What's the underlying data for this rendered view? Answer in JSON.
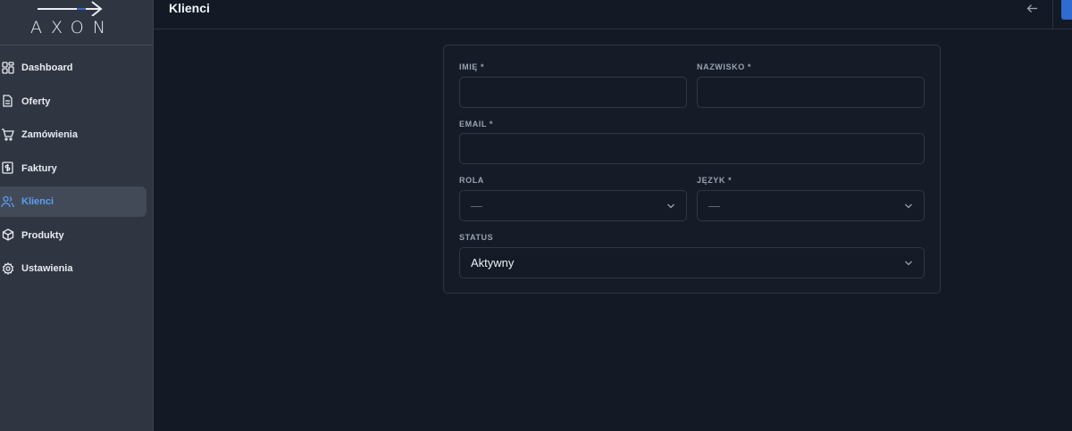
{
  "brand": {
    "name": "AXON",
    "accent": "#2f6bd0"
  },
  "sidebar": {
    "items": [
      {
        "label": "Dashboard",
        "icon": "dashboard-icon"
      },
      {
        "label": "Oferty",
        "icon": "document-icon"
      },
      {
        "label": "Zamówienia",
        "icon": "cart-icon"
      },
      {
        "label": "Faktury",
        "icon": "invoice-icon"
      },
      {
        "label": "Klienci",
        "icon": "users-icon",
        "active": true
      },
      {
        "label": "Produkty",
        "icon": "box-icon"
      },
      {
        "label": "Ustawienia",
        "icon": "gear-icon"
      }
    ]
  },
  "header": {
    "title": "Klienci",
    "back_icon": "arrow-left-icon"
  },
  "form": {
    "first_name": {
      "label": "IMIĘ *",
      "value": ""
    },
    "last_name": {
      "label": "NAZWISKO *",
      "value": ""
    },
    "email": {
      "label": "EMAIL *",
      "value": ""
    },
    "role": {
      "label": "ROLA",
      "value": "—"
    },
    "language": {
      "label": "JĘZYK *",
      "value": "—"
    },
    "status": {
      "label": "STATUS",
      "value": "Aktywny"
    }
  }
}
